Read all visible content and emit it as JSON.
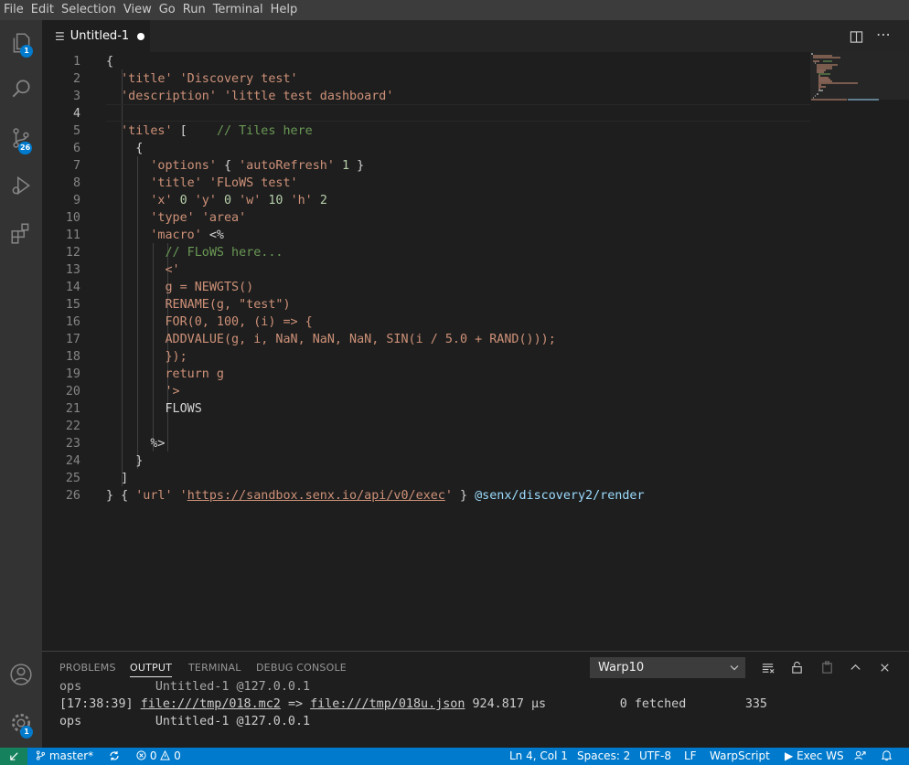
{
  "menu": [
    "File",
    "Edit",
    "Selection",
    "View",
    "Go",
    "Run",
    "Terminal",
    "Help"
  ],
  "activity": {
    "explorer_badge": "1",
    "scm_badge": "26",
    "settings_badge": "1"
  },
  "tab": {
    "label": "Untitled-1",
    "modified": true
  },
  "editor": {
    "lines": [
      {
        "n": "1"
      },
      {
        "n": "2"
      },
      {
        "n": "3"
      },
      {
        "n": "4"
      },
      {
        "n": "5"
      },
      {
        "n": "6"
      },
      {
        "n": "7"
      },
      {
        "n": "8"
      },
      {
        "n": "9"
      },
      {
        "n": "10"
      },
      {
        "n": "11"
      },
      {
        "n": "12"
      },
      {
        "n": "13"
      },
      {
        "n": "14"
      },
      {
        "n": "15"
      },
      {
        "n": "16"
      },
      {
        "n": "17"
      },
      {
        "n": "18"
      },
      {
        "n": "19"
      },
      {
        "n": "20"
      },
      {
        "n": "21"
      },
      {
        "n": "22"
      },
      {
        "n": "23"
      },
      {
        "n": "24"
      },
      {
        "n": "25"
      },
      {
        "n": "26"
      }
    ],
    "code": {
      "l1": "{",
      "l2a": "'title'",
      "l2b": "'Discovery test'",
      "l3a": "'description'",
      "l3b": "'little test dashboard'",
      "l5a": "'tiles'",
      "l5b": "[",
      "l5c": "// Tiles here",
      "l6": "{",
      "l7a": "'options'",
      "l7b": "{",
      "l7c": "'autoRefresh'",
      "l7d": "1",
      "l7e": "}",
      "l8a": "'title'",
      "l8b": "'FLoWS test'",
      "l9a": "'x'",
      "l9b": "0",
      "l9c": "'y'",
      "l9d": "0",
      "l9e": "'w'",
      "l9f": "10",
      "l9g": "'h'",
      "l9h": "2",
      "l10a": "'type'",
      "l10b": "'area'",
      "l11a": "'macro'",
      "l11b": "<%",
      "l12": "// FLoWS here...",
      "l13": "<'",
      "l14": "g = NEWGTS()",
      "l15": "RENAME(g, \"test\")",
      "l16": "FOR(0, 100, (i) => {",
      "l17": "ADDVALUE(g, i, NaN, NaN, NaN, SIN(i / 5.0 + RAND()));",
      "l18": "});",
      "l19": "return g",
      "l20": "'>",
      "l21": "FLOWS",
      "l23": "%>",
      "l24": "}",
      "l25": "]",
      "l26a": "}",
      "l26b": "{",
      "l26c": "'url'",
      "l26d": "'",
      "l26e": "https://sandbox.senx.io/api/v0/exec",
      "l26f": "'",
      "l26g": "}",
      "l26h": "@senx/discovery2/render"
    }
  },
  "panel": {
    "tabs": [
      "PROBLEMS",
      "OUTPUT",
      "TERMINAL",
      "DEBUG CONSOLE"
    ],
    "active_tab": "OUTPUT",
    "channel": "Warp10",
    "output": {
      "r1a": "ops",
      "r1b": "Untitled-1 @127.0.0.1",
      "r2a": "[17:38:39]",
      "r2b": "file:///tmp/018.mc2",
      "r2c": "=>",
      "r2d": "file:///tmp/018u.json",
      "r2e": "924.817 µs",
      "r2f": "0 fetched",
      "r2g": "335",
      "r3a": "ops",
      "r3b": "Untitled-1 @127.0.0.1"
    }
  },
  "status": {
    "branch": "master*",
    "errors": "0",
    "warnings": "0",
    "position": "Ln 4, Col 1",
    "spaces": "Spaces: 2",
    "encoding": "UTF-8",
    "eol": "LF",
    "language": "WarpScript",
    "exec": "Exec WS"
  },
  "colors": {
    "status_bar": "#007acc",
    "remote": "#16825d",
    "badge": "#007acc",
    "string": "#ce9178",
    "comment": "#6a9955",
    "number": "#b5cea8"
  }
}
